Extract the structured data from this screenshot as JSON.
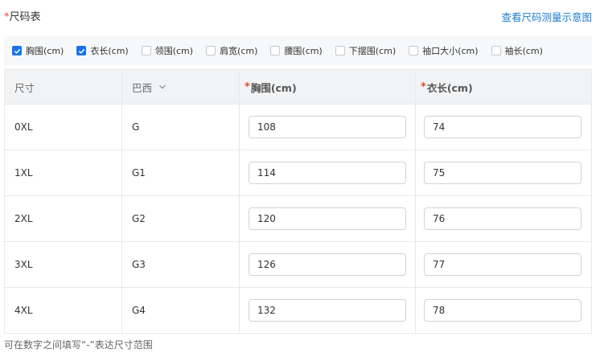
{
  "header": {
    "required_mark": "*",
    "title": "尺码表",
    "help_link": "查看尺码测量示意图"
  },
  "measurements": [
    {
      "label": "胸围(cm)",
      "checked": true
    },
    {
      "label": "衣长(cm)",
      "checked": true
    },
    {
      "label": "领围(cm)",
      "checked": false
    },
    {
      "label": "肩宽(cm)",
      "checked": false
    },
    {
      "label": "腰围(cm)",
      "checked": false
    },
    {
      "label": "下摆围(cm)",
      "checked": false
    },
    {
      "label": "袖口大小(cm)",
      "checked": false
    },
    {
      "label": "袖长(cm)",
      "checked": false
    }
  ],
  "table": {
    "columns": {
      "size": "尺寸",
      "region": "巴西",
      "chest": "胸围(cm)",
      "length": "衣长(cm)",
      "required_mark": "*"
    },
    "rows": [
      {
        "size": "0XL",
        "region": "G",
        "chest": "108",
        "length": "74"
      },
      {
        "size": "1XL",
        "region": "G1",
        "chest": "114",
        "length": "75"
      },
      {
        "size": "2XL",
        "region": "G2",
        "chest": "120",
        "length": "76"
      },
      {
        "size": "3XL",
        "region": "G3",
        "chest": "126",
        "length": "77"
      },
      {
        "size": "4XL",
        "region": "G4",
        "chest": "132",
        "length": "78"
      }
    ]
  },
  "footer": {
    "hint": "可在数字之间填写“-”表达尺寸范围"
  },
  "colors": {
    "accent": "#1a73e8",
    "link": "#1e7ccf",
    "required": "#e34d33"
  }
}
